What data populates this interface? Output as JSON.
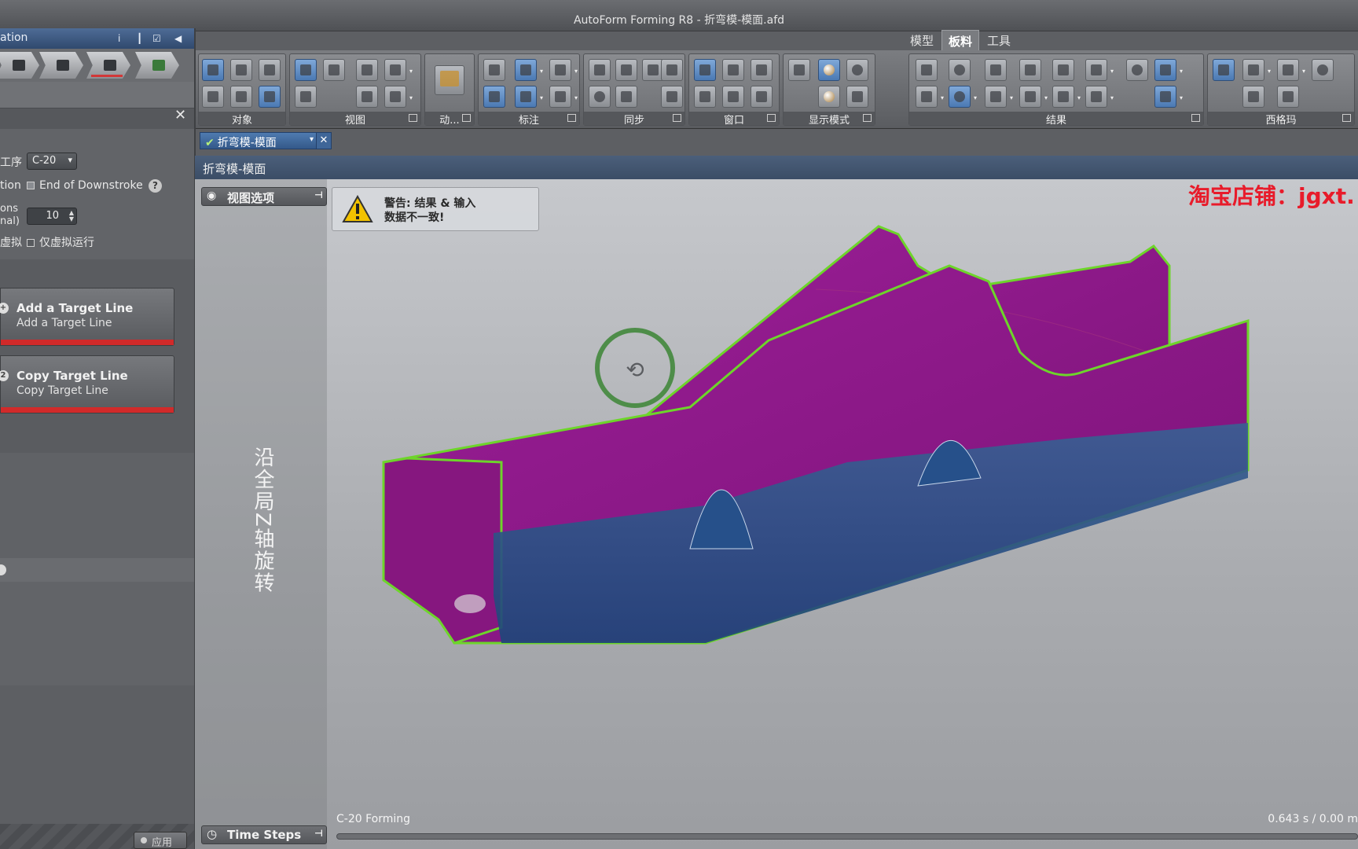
{
  "window": {
    "title": "AutoForm Forming R8 - 折弯模-模面.afd"
  },
  "ribbon": {
    "tabs": [
      {
        "label": "模型",
        "active": false
      },
      {
        "label": "板料",
        "active": true
      },
      {
        "label": "工具",
        "active": false
      }
    ],
    "groups": {
      "objects": "对象",
      "view": "视图",
      "animation": "动...",
      "annotation": "标注",
      "sync": "同步",
      "window": "窗口",
      "display_mode": "显示模式",
      "results": "结果",
      "ximagma": "西格玛"
    }
  },
  "left_panel": {
    "header": "ation",
    "op_label": "工序",
    "op_value": "C-20",
    "position_label": "tion",
    "position_value": "End of Downstroke",
    "iterations_label_1": "ons",
    "iterations_label_2": "nal)",
    "iterations_value": "10",
    "virtual_label": "虚拟",
    "virtual_check_label": "仅虚拟运行",
    "help_glyph": "?",
    "actions": [
      {
        "icon_text": "+",
        "title": "Add a Target Line",
        "subtitle": "Add a Target Line"
      },
      {
        "icon_text": "2",
        "title": "Copy Target Line",
        "subtitle": "Copy Target Line"
      }
    ],
    "apply_label": "应用"
  },
  "document": {
    "tab_label": "折弯模-模面",
    "view_title": "折弯模-模面"
  },
  "viewport": {
    "view_options_label": "视图选项",
    "warning_line1": "警告: 结果 & 输入",
    "warning_line2": "数据不一致!",
    "rotate_hint": "沿全局Z轴旋转",
    "watermark": "淘宝店铺：jgxt.",
    "status_left": "C-20 Forming",
    "status_right": "0.643 s / 0.00 m",
    "time_steps_label": "Time Steps",
    "colors": {
      "part_magenta": "#8f1a8c",
      "part_blue": "#2d5a8e",
      "edge_green": "#6dd52a",
      "watermark_red": "#e81b2a"
    }
  }
}
